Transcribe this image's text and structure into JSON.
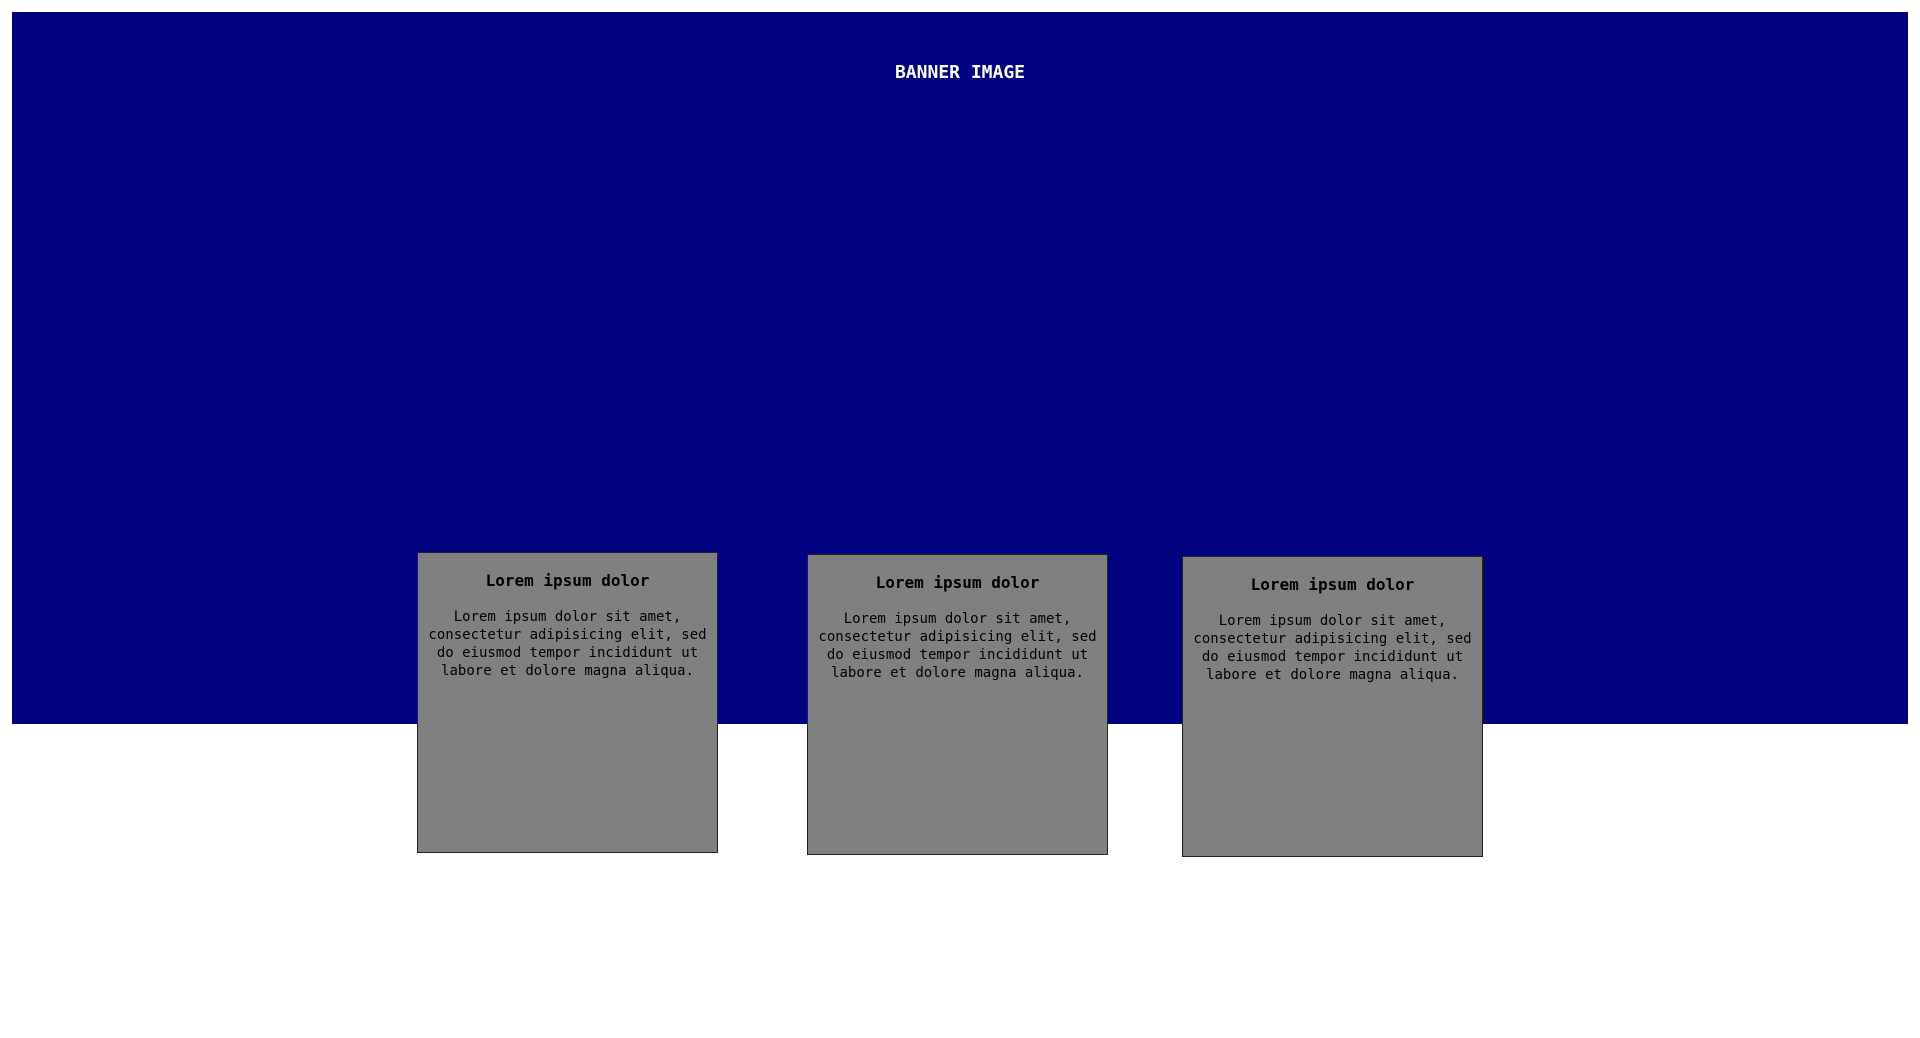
{
  "banner": {
    "label": "BANNER IMAGE",
    "color": "#020381"
  },
  "cards": [
    {
      "title": "Lorem ipsum dolor",
      "body": "Lorem ipsum dolor sit amet, consectetur adipisicing elit, sed do eiusmod tempor incididunt ut labore et dolore magna aliqua."
    },
    {
      "title": "Lorem ipsum dolor",
      "body": "Lorem ipsum dolor sit amet, consectetur adipisicing elit, sed do eiusmod tempor incididunt ut labore et dolore magna aliqua."
    },
    {
      "title": "Lorem ipsum dolor",
      "body": "Lorem ipsum dolor sit amet, consectetur adipisicing elit, sed do eiusmod tempor incididunt ut labore et dolore magna aliqua."
    }
  ],
  "colors": {
    "card_background": "#808080",
    "page_background": "#ffffff"
  }
}
